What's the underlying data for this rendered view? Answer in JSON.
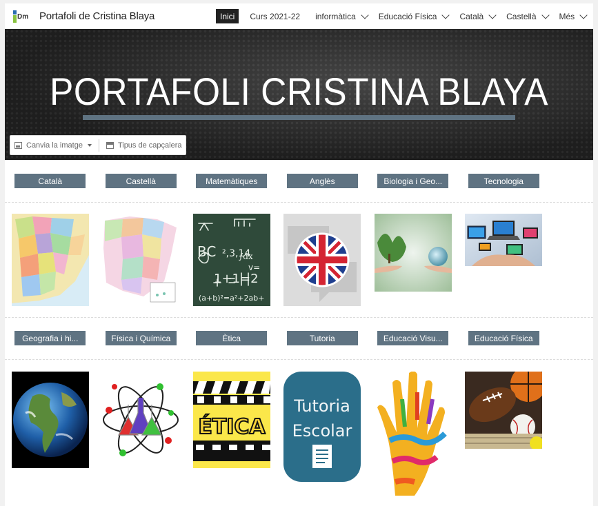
{
  "site": {
    "title": "Portafoli de Cristina Blaya"
  },
  "nav": [
    {
      "label": "Inici",
      "active": true,
      "dropdown": false
    },
    {
      "label": "Curs 2021-22",
      "active": false,
      "dropdown": false
    },
    {
      "label": "informàtica",
      "active": false,
      "dropdown": true
    },
    {
      "label": "Educació Física",
      "active": false,
      "dropdown": true
    },
    {
      "label": "Català",
      "active": false,
      "dropdown": true
    },
    {
      "label": "Castellà",
      "active": false,
      "dropdown": true
    },
    {
      "label": "Més",
      "active": false,
      "dropdown": true
    }
  ],
  "hero": {
    "title": "PORTAFOLI CRISTINA BLAYA",
    "change_image": "Canvia la imatge",
    "header_type": "Tipus de capçalera"
  },
  "subjects_row1": [
    "Català",
    "Castellà",
    "Matemàtiques",
    "Anglès",
    "Biologia i Geo...",
    "Tecnologia"
  ],
  "subjects_row2": [
    "Geografia i hi...",
    "Física i Química",
    "Ètica",
    "Tutoria",
    "Educació Visu...",
    "Educació Física"
  ],
  "images_row2_text": {
    "etica": "ÉTICA",
    "tutoria_line1": "Tutoria",
    "tutoria_line2": "Escolar"
  },
  "colors": {
    "button": "#5f7382",
    "nav_active": "#222222",
    "hero_bar": "#5f7382"
  }
}
